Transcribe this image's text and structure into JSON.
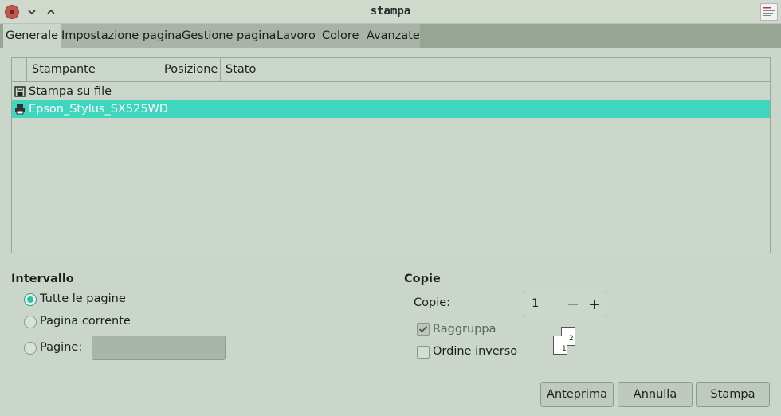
{
  "window": {
    "title": "stampa",
    "close_icon": "close-icon",
    "minimize_icon": "chevron-down-icon",
    "maximize_icon": "chevron-up-icon"
  },
  "tabs": [
    {
      "label": "Generale",
      "active": true
    },
    {
      "label": "Impostazione pagina",
      "active": false
    },
    {
      "label": "Gestione pagina",
      "active": false
    },
    {
      "label": "Lavoro",
      "active": false
    },
    {
      "label": "Colore",
      "active": false
    },
    {
      "label": "Avanzate",
      "active": false
    }
  ],
  "printer_list": {
    "columns": [
      "Stampante",
      "Posizione",
      "Stato"
    ],
    "rows": [
      {
        "name": "Stampa su file",
        "icon": "save-file-icon",
        "selected": false
      },
      {
        "name": "Epson_Stylus_SX525WD",
        "icon": "printer-icon",
        "selected": true
      }
    ]
  },
  "range": {
    "title": "Intervallo",
    "all_pages": "Tutte le pagine",
    "current_page": "Pagina corrente",
    "pages": "Pagine:",
    "pages_value": "",
    "selected": "all_pages"
  },
  "copies": {
    "title": "Copie",
    "label": "Copie:",
    "value": "1",
    "collate": "Raggruppa",
    "collate_checked": true,
    "reverse": "Ordine inverso",
    "reverse_checked": false,
    "collate_pages": [
      "1",
      "2"
    ]
  },
  "buttons": {
    "preview": "Anteprima",
    "cancel": "Annulla",
    "print": "Stampa"
  },
  "colors": {
    "accent": "#3ed6bc",
    "background": "#cad6ca"
  }
}
